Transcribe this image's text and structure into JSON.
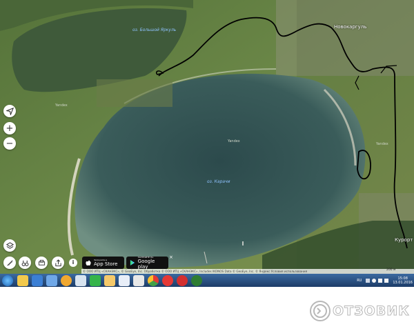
{
  "map": {
    "labels": {
      "lake_north": "оз. Большой Яркуль",
      "lake_main": "оз. Карачи",
      "village_north": "Новокаргуль",
      "village_south": "Курорт",
      "watermark_1": "Yandex",
      "watermark_2": "Yandex",
      "watermark_3": "Yandex"
    },
    "controls": {
      "locate_icon": "navigation-arrow-icon",
      "zoom_in_label": "+",
      "zoom_out_label": "−",
      "layers_icon": "layers-icon",
      "ruler_icon": "ruler-icon",
      "binoculars_icon": "binoculars-icon",
      "print_icon": "print-icon",
      "share_icon": "share-icon",
      "info_label": "i"
    },
    "app_store": {
      "small": "Загрузите в",
      "big": "App Store"
    },
    "google_play": {
      "small": "ЗАГРУЗИТЕ НА",
      "big": "Google play"
    },
    "close_label": "×",
    "copyright": "© ООО ИТЦ «СКАНЭКС», © GeoEye, Inc. Обработка © ООО ИТЦ «СКАНЭКС», Includes IKONOS Data © GeoEye, Inc. © Яндекс Условия использования",
    "scale": "200 м"
  },
  "taskbar": {
    "icons": [
      "explorer-folder-icon",
      "media-player-icon",
      "speaker-app-icon",
      "aimp-icon",
      "spreadsheet-icon",
      "calculator-icon",
      "folder-icon",
      "paint-icon",
      "music-icon",
      "chrome-icon",
      "yandex-browser-icon",
      "opera-icon",
      "feather-icon"
    ],
    "lang": "RU",
    "time": "15:08",
    "date": "13.01.2016"
  },
  "brand": {
    "name": "ОТЗОВИК"
  },
  "colors": {
    "water": "#2f4e4f",
    "land": "#5c7a3c",
    "route": "#000000",
    "taskbar": "#2a5289"
  }
}
